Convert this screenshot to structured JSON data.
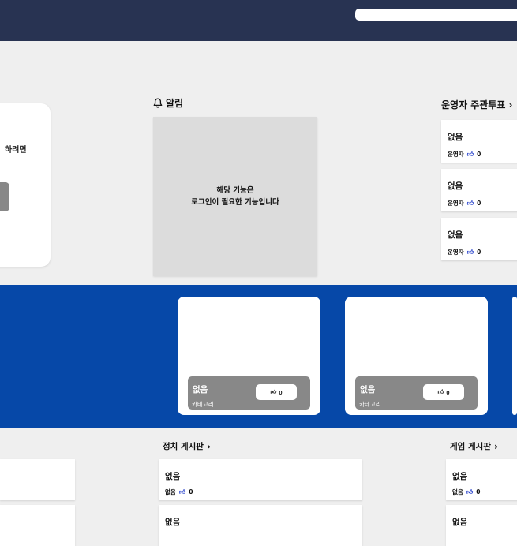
{
  "header": {
    "search_placeholder": ""
  },
  "login": {
    "text": "하려면"
  },
  "notice": {
    "title": "알림",
    "message_line1": "해당 기능은",
    "message_line2": "로그인이 필요한 기능입니다"
  },
  "admin_vote": {
    "title": "운영자 주관투표",
    "items": [
      {
        "title": "없음",
        "author": "운영자",
        "likes": "0"
      },
      {
        "title": "없음",
        "author": "운영자",
        "likes": "0"
      },
      {
        "title": "없음",
        "author": "운영자",
        "likes": "0"
      }
    ]
  },
  "featured": [
    {
      "title": "없음",
      "category": "카테고리",
      "likes": "0"
    },
    {
      "title": "없음",
      "category": "카테고리",
      "likes": "0"
    }
  ],
  "politics_board": {
    "title": "정치 게시판",
    "items": [
      {
        "title": "없음",
        "author": "없음",
        "likes": "0"
      },
      {
        "title": "없음"
      }
    ]
  },
  "game_board": {
    "title": "게임 게시판",
    "items": [
      {
        "title": "없음",
        "author": "없음",
        "likes": "0"
      },
      {
        "title": "없음"
      }
    ]
  }
}
